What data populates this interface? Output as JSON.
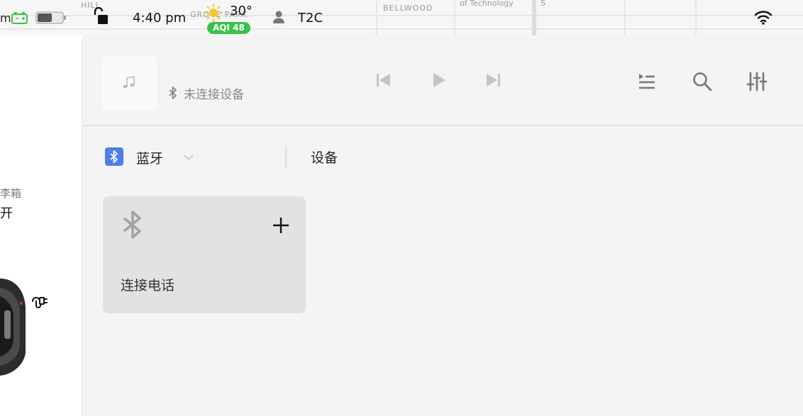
{
  "status_bar": {
    "range_unit": "m",
    "time": "4:40 pm",
    "temperature": "30°",
    "aqi": "AQI 48",
    "profile": "T2C",
    "icons": [
      "battery-charging-icon",
      "battery-level-icon",
      "unlock-icon",
      "sun-icon",
      "user-icon",
      "wifi-icon"
    ],
    "aqi_color": "#3cc24a"
  },
  "map": {
    "labels": [
      "HILL",
      "GROVE PARK",
      "BELLWOOD",
      "of Technology",
      "S"
    ]
  },
  "vehicle": {
    "trunk_label": "李箱",
    "trunk_state": "开"
  },
  "media": {
    "album_icon": "music-note-icon",
    "connection_status": "未连接设备",
    "controls": [
      "previous-track-icon",
      "play-icon",
      "next-track-icon"
    ],
    "tools": [
      "queue-icon",
      "search-icon",
      "equalizer-icon"
    ],
    "source": {
      "name": "蓝牙",
      "accent": "#4f7ee8"
    },
    "devices_title": "设备",
    "card": {
      "label": "连接电话"
    }
  }
}
